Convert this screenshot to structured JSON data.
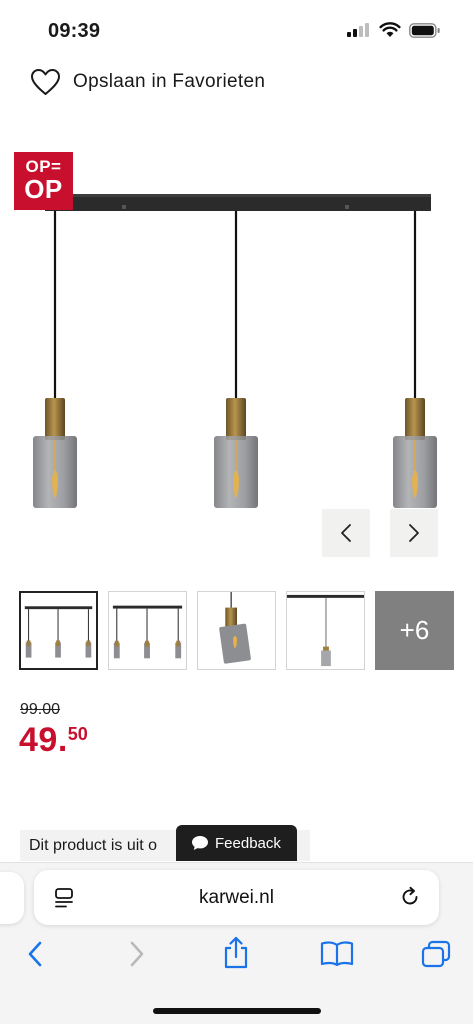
{
  "status_bar": {
    "time": "09:39"
  },
  "favorites": {
    "label": "Opslaan in Favorieten",
    "icon": "heart-outline-icon"
  },
  "badge": {
    "line1": "OP=",
    "line2": "OP",
    "color": "#c8102e"
  },
  "gallery": {
    "more_label": "+6",
    "prev_icon": "chevron-left-icon",
    "next_icon": "chevron-right-icon"
  },
  "price": {
    "old": "99.00",
    "main": "49.",
    "cents": "50",
    "accent": "#c8102e"
  },
  "notice": {
    "text": "Dit product is uit o"
  },
  "feedback": {
    "label": "Feedback",
    "icon": "speech-bubble-icon"
  },
  "browser": {
    "url": "karwei.nl"
  }
}
